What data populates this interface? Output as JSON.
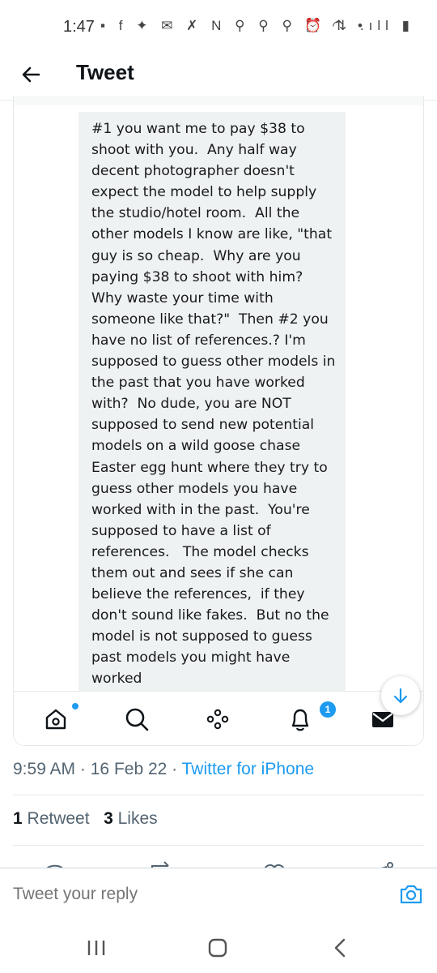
{
  "status_bar": {
    "time": "1:47",
    "left_icons": "▪ f ✦ ✉ ✗ N ⚲ ⚲ ⚲ ▣ ◠ •",
    "right_icons": "⏰ ⇅ .ıll ▮"
  },
  "header": {
    "title": "Tweet",
    "back_icon": "back-arrow-icon"
  },
  "media": {
    "text": "#1 you want me to pay $38 to shoot with you.  Any half way decent photographer doesn't expect the model to help supply the studio/hotel room.  All the other models I know are like, \"that guy is so cheap.  Why are you paying $38 to shoot with him?  Why waste your time with someone like that?\"  Then #2 you have no list of references.? I'm supposed to guess other models in the past that you have worked with?  No dude, you are NOT supposed to send new potential models on a wild goose chase Easter egg hunt where they try to guess other models you have worked with in the past.  You're supposed to have a list of references.   The model checks them out and sees if she can believe the references,  if they don't sound like fakes.  But no the model is not supposed to guess past models you might have worked"
  },
  "screenshot_nav": {
    "icons": [
      "home-icon",
      "search-icon",
      "spaces-icon",
      "notifications-icon",
      "messages-icon"
    ],
    "notification_count": "1"
  },
  "meta": {
    "time": "9:59 AM",
    "separator": "·",
    "date": "16 Feb 22",
    "source": "Twitter for iPhone"
  },
  "stats": {
    "retweet_count": "1",
    "retweet_label": "Retweet",
    "likes_count": "3",
    "likes_label": "Likes"
  },
  "reply": {
    "placeholder": "Tweet your reply"
  },
  "colors": {
    "accent": "#1d9bf0",
    "secondary_text": "#536471",
    "primary_text": "#0f1419"
  }
}
